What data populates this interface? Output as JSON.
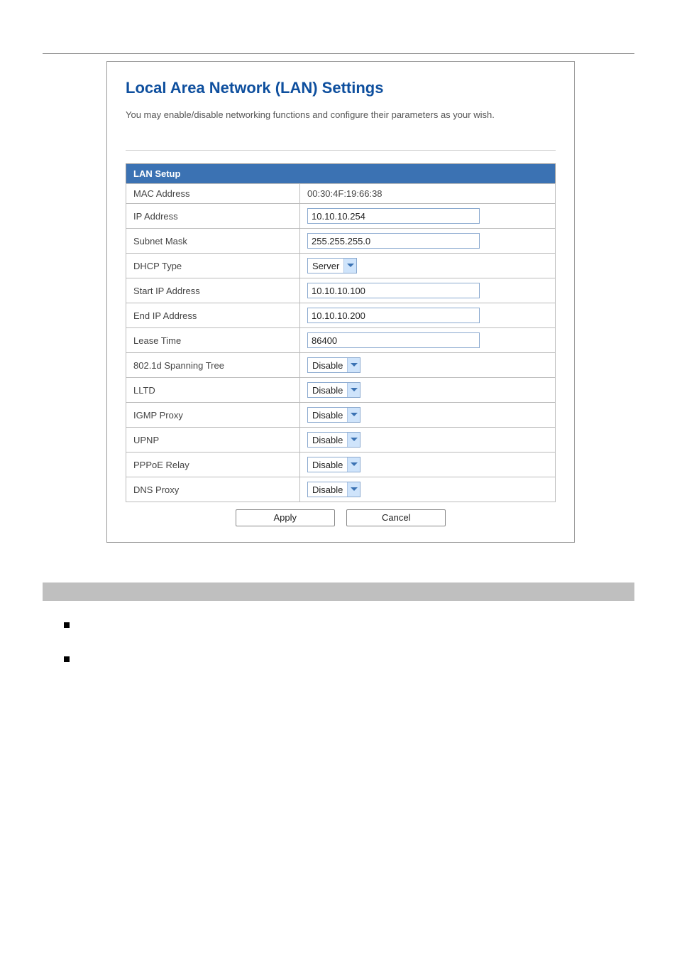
{
  "header": {
    "title": "Local Area Network (LAN) Settings",
    "description": "You may enable/disable networking functions and configure their parameters as your wish."
  },
  "section_title": "LAN Setup",
  "fields": {
    "mac_address": {
      "label": "MAC Address",
      "value": "00:30:4F:19:66:38"
    },
    "ip_address": {
      "label": "IP Address",
      "value": "10.10.10.254"
    },
    "subnet_mask": {
      "label": "Subnet Mask",
      "value": "255.255.255.0"
    },
    "dhcp_type": {
      "label": "DHCP Type",
      "value": "Server"
    },
    "start_ip": {
      "label": "Start IP Address",
      "value": "10.10.10.100"
    },
    "end_ip": {
      "label": "End IP Address",
      "value": "10.10.10.200"
    },
    "lease_time": {
      "label": "Lease Time",
      "value": "86400"
    },
    "spanning_tree": {
      "label": "802.1d Spanning Tree",
      "value": "Disable"
    },
    "lltd": {
      "label": "LLTD",
      "value": "Disable"
    },
    "igmp_proxy": {
      "label": "IGMP Proxy",
      "value": "Disable"
    },
    "upnp": {
      "label": "UPNP",
      "value": "Disable"
    },
    "pppoe_relay": {
      "label": "PPPoE Relay",
      "value": "Disable"
    },
    "dns_proxy": {
      "label": "DNS Proxy",
      "value": "Disable"
    }
  },
  "buttons": {
    "apply": "Apply",
    "cancel": "Cancel"
  }
}
